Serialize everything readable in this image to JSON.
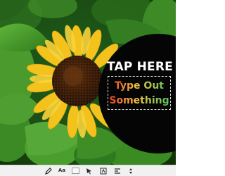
{
  "canvas": {
    "photo_subject": "sunflower",
    "overlay_color": "#050505"
  },
  "text_overlay": {
    "prompt": "TAP HERE",
    "line1": "Type Out",
    "line2": "Something",
    "prompt_color": "#ffffff",
    "gradient_colors": [
      "#e33a21",
      "#f5c242",
      "#4fc35d"
    ]
  },
  "toolbar": {
    "font_size_label": "Aa",
    "icons": [
      "pen-icon",
      "font-size-button",
      "color-swatch-icon",
      "cursor-icon",
      "text-size-icon",
      "align-icon",
      "adjust-icon"
    ]
  }
}
